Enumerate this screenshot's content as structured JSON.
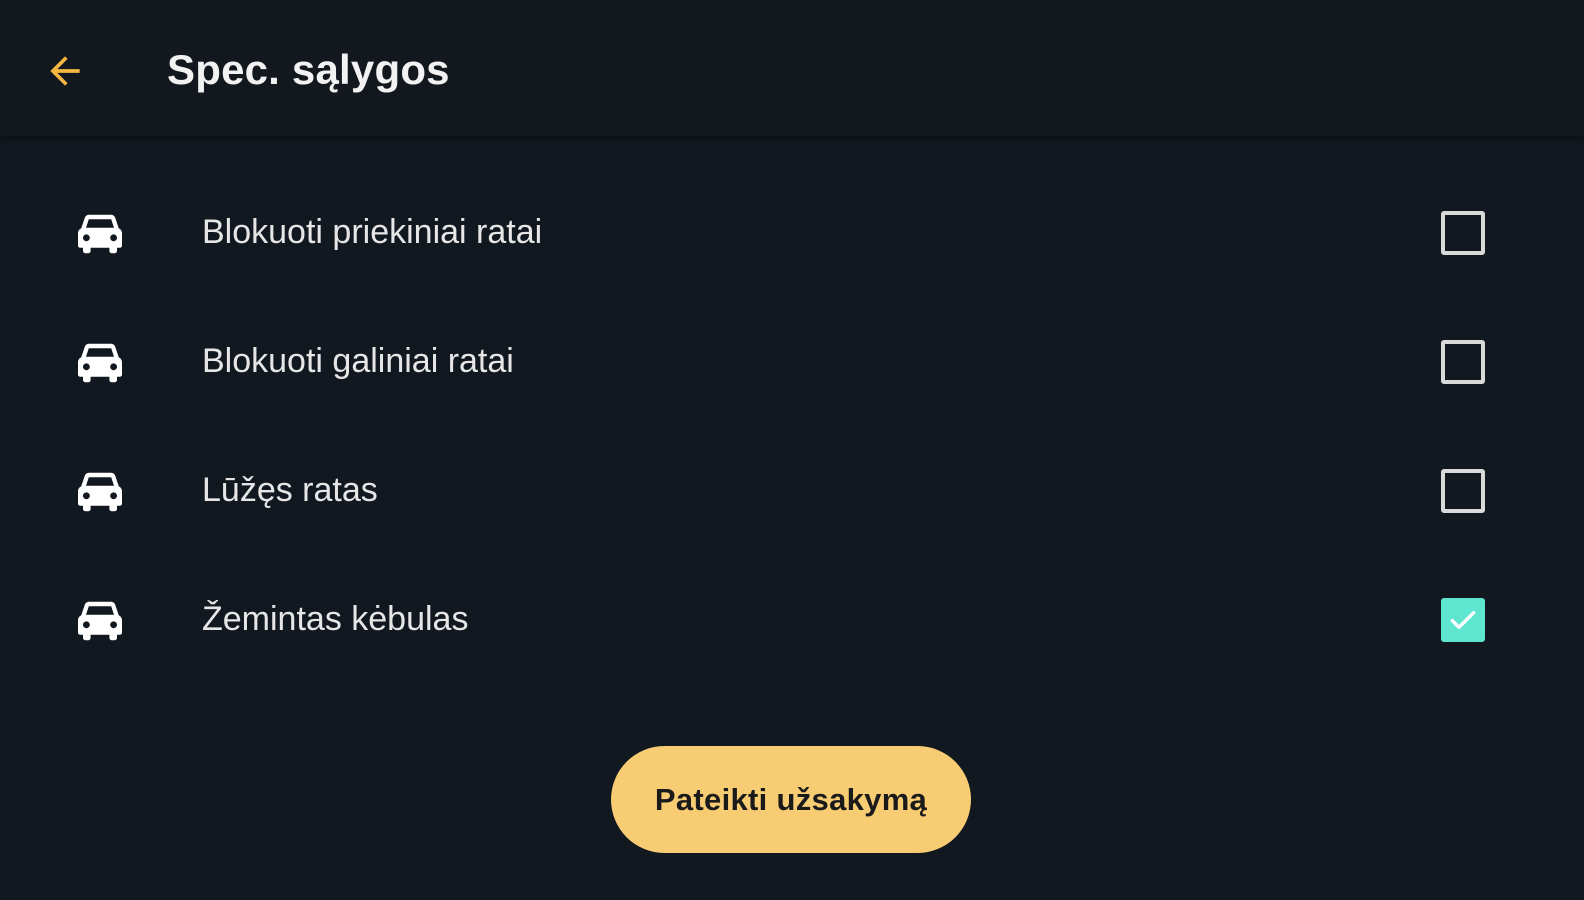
{
  "header": {
    "title": "Spec. sąlygos",
    "back_icon": "arrow-left-icon",
    "accent_color": "#f5b742"
  },
  "options": [
    {
      "label": "Blokuoti priekiniai ratai",
      "icon": "car-icon",
      "checked": false
    },
    {
      "label": "Blokuoti galiniai ratai",
      "icon": "car-icon",
      "checked": false
    },
    {
      "label": "Lūžęs ratas",
      "icon": "car-icon",
      "checked": false
    },
    {
      "label": "Žemintas kėbulas",
      "icon": "car-icon",
      "checked": true
    }
  ],
  "submit": {
    "label": "Pateikti užsakymą",
    "color": "#f7cc73"
  },
  "colors": {
    "background": "#121820",
    "checkbox_checked": "#5fe6d0"
  }
}
